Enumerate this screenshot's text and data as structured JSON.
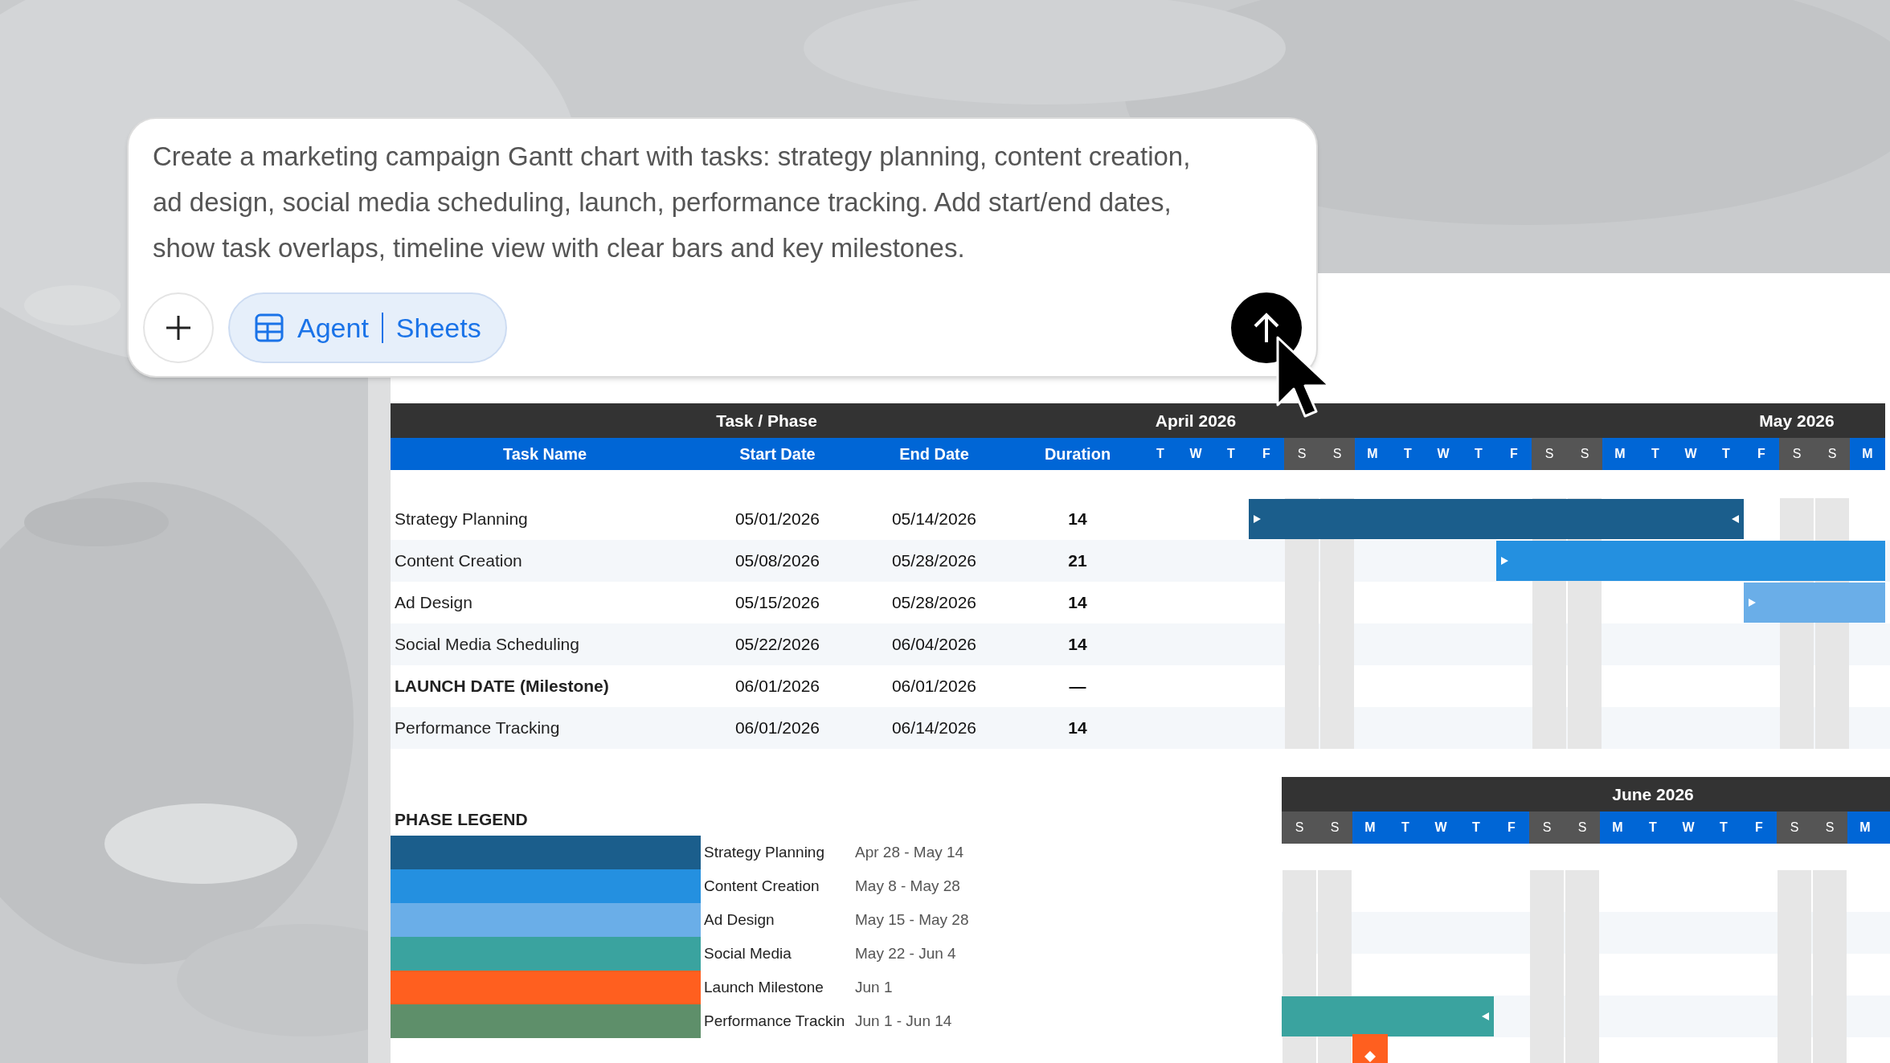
{
  "prompt": {
    "text": "Create a marketing campaign Gantt chart with tasks: strategy planning, content creation, ad design, social media scheduling, launch, performance tracking. Add start/end dates, show task overlaps, timeline view with clear bars and key milestones.",
    "chip_agent": "Agent",
    "chip_sheets": "Sheets"
  },
  "sheet": {
    "group_header": "Task / Phase",
    "columns": [
      "Task Name",
      "Start Date",
      "End Date",
      "Duration"
    ],
    "days": [
      {
        "label": "T",
        "weekend": false
      },
      {
        "label": "W",
        "weekend": false,
        "month": "April 2026"
      },
      {
        "label": "T",
        "weekend": false
      },
      {
        "label": "F",
        "weekend": false
      },
      {
        "label": "S",
        "weekend": true
      },
      {
        "label": "S",
        "weekend": true
      },
      {
        "label": "M",
        "weekend": false
      },
      {
        "label": "T",
        "weekend": false
      },
      {
        "label": "W",
        "weekend": false
      },
      {
        "label": "T",
        "weekend": false
      },
      {
        "label": "F",
        "weekend": false
      },
      {
        "label": "S",
        "weekend": true
      },
      {
        "label": "S",
        "weekend": true
      },
      {
        "label": "M",
        "weekend": false
      },
      {
        "label": "T",
        "weekend": false
      },
      {
        "label": "W",
        "weekend": false
      },
      {
        "label": "T",
        "weekend": false
      },
      {
        "label": "F",
        "weekend": false
      },
      {
        "label": "S",
        "weekend": true,
        "month": "May 2026"
      },
      {
        "label": "S",
        "weekend": true
      },
      {
        "label": "M",
        "weekend": false
      }
    ],
    "tasks": [
      {
        "name": "Strategy Planning",
        "bold": false,
        "start": "05/01/2026",
        "end": "05/14/2026",
        "duration": "14",
        "bar": {
          "kind": "bar",
          "start_mark": true,
          "end_mark": true,
          "color": "#1b5e8c"
        }
      },
      {
        "name": "Content Creation",
        "bold": false,
        "start": "05/08/2026",
        "end": "05/28/2026",
        "duration": "21",
        "bar": {
          "kind": "bar",
          "start_mark": true,
          "end_mark": false,
          "color": "#2490e0"
        }
      },
      {
        "name": "Ad Design",
        "bold": false,
        "start": "05/15/2026",
        "end": "05/28/2026",
        "duration": "14",
        "bar": {
          "kind": "bar",
          "start_mark": true,
          "end_mark": false,
          "color": "#6aaee8"
        }
      },
      {
        "name": "Social Media Scheduling",
        "bold": false,
        "start": "05/22/2026",
        "end": "06/04/2026",
        "duration": "14",
        "june_bar": {
          "kind": "bar",
          "start_mark": false,
          "end_mark": true,
          "color": "#3aa39f"
        }
      },
      {
        "name": "LAUNCH DATE (Milestone)",
        "bold": true,
        "start": "06/01/2026",
        "end": "06/01/2026",
        "duration": "—",
        "june_bar": {
          "kind": "milestone",
          "color": "#ff5f1f"
        }
      },
      {
        "name": "Performance Tracking",
        "bold": false,
        "start": "06/01/2026",
        "end": "06/14/2026",
        "duration": "14"
      }
    ]
  },
  "june": {
    "days": [
      {
        "label": "S",
        "weekend": true
      },
      {
        "label": "S",
        "weekend": true
      },
      {
        "label": "M",
        "weekend": false
      },
      {
        "label": "T",
        "weekend": false
      },
      {
        "label": "W",
        "weekend": false
      },
      {
        "label": "T",
        "weekend": false
      },
      {
        "label": "F",
        "weekend": false
      },
      {
        "label": "S",
        "weekend": true
      },
      {
        "label": "S",
        "weekend": true
      },
      {
        "label": "M",
        "weekend": false
      },
      {
        "label": "T",
        "weekend": false,
        "month": "June 2026"
      },
      {
        "label": "W",
        "weekend": false
      },
      {
        "label": "T",
        "weekend": false
      },
      {
        "label": "F",
        "weekend": false
      },
      {
        "label": "S",
        "weekend": true
      },
      {
        "label": "S",
        "weekend": true
      },
      {
        "label": "M",
        "weekend": false
      }
    ]
  },
  "legend": {
    "title": "PHASE LEGEND",
    "items": [
      {
        "label": "Strategy Planning",
        "dates": "Apr 28 - May 14",
        "color": "#1b5e8c"
      },
      {
        "label": "Content Creation",
        "dates": "May 8 - May 28",
        "color": "#2490e0"
      },
      {
        "label": "Ad Design",
        "dates": "May 15 - May 28",
        "color": "#6aaee8"
      },
      {
        "label": "Social Media",
        "dates": "May 22 - Jun 4",
        "color": "#3aa39f"
      },
      {
        "label": "Launch Milestone",
        "dates": "Jun 1",
        "color": "#ff5f1f"
      },
      {
        "label": "Performance Trackin",
        "dates": "Jun 1 - Jun 14",
        "color": "#5e8f6a"
      }
    ]
  }
}
